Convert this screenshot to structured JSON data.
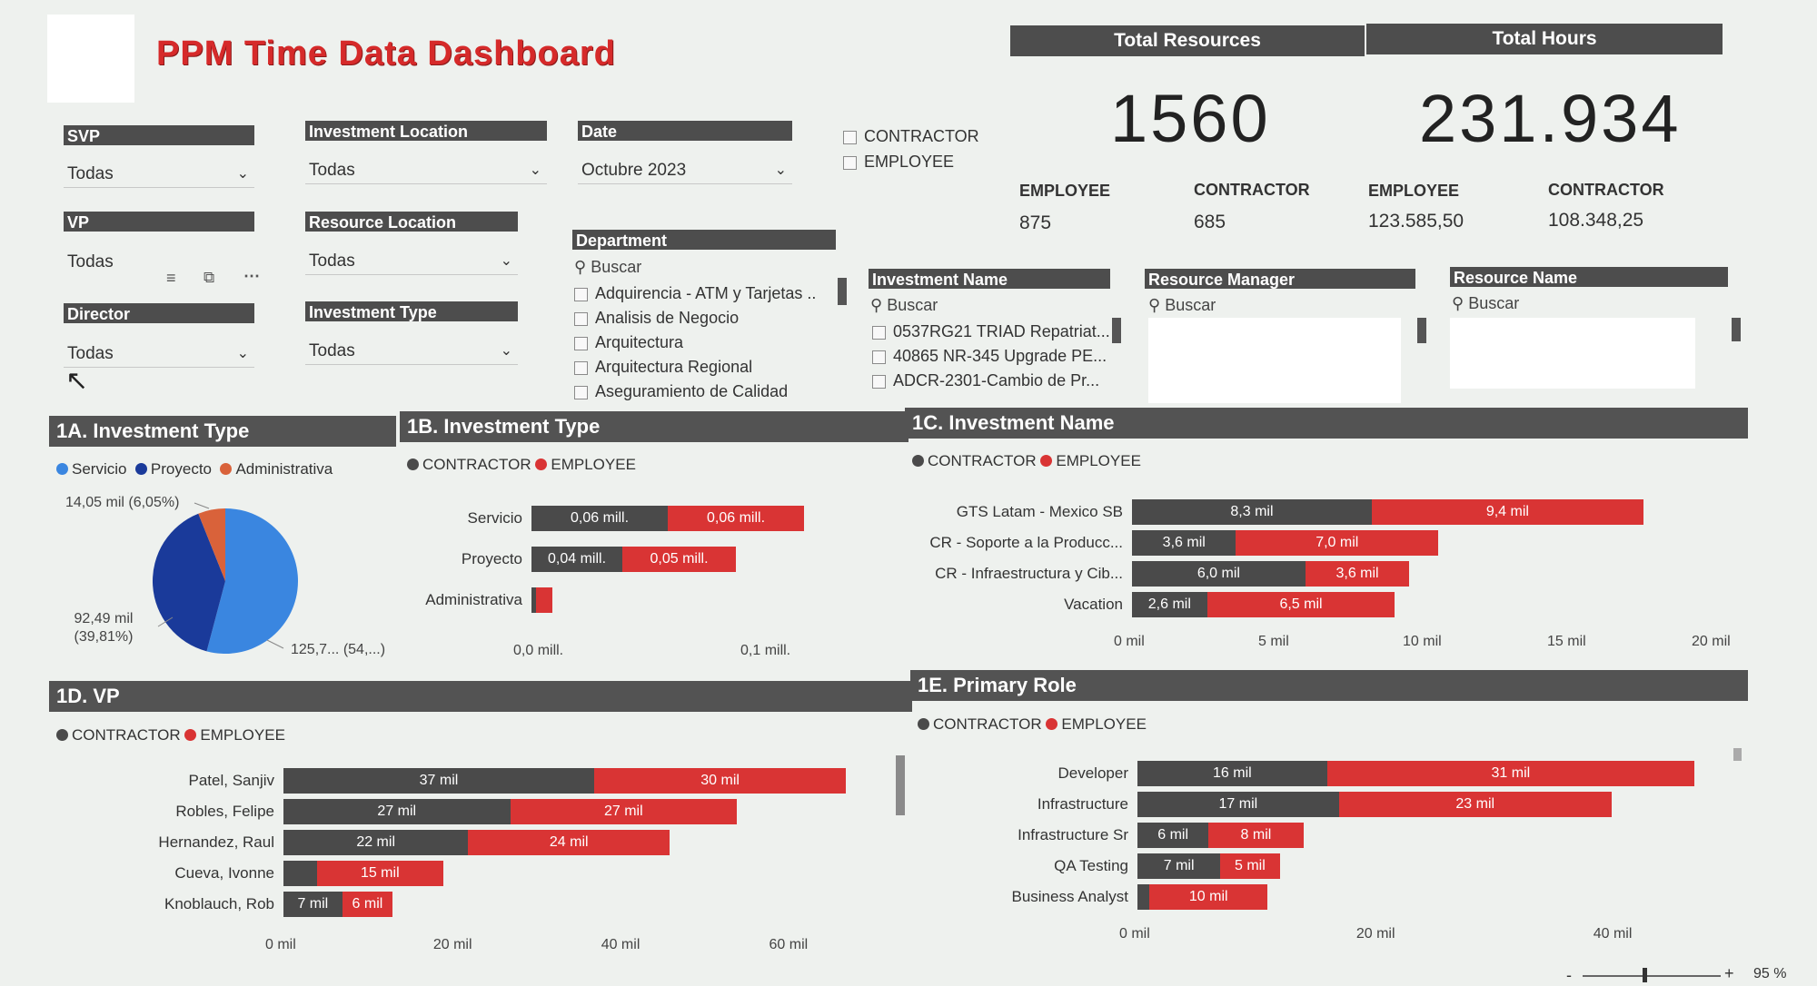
{
  "header": {
    "title": "PPM Time Data Dashboard"
  },
  "filters": {
    "svp": {
      "label": "SVP",
      "value": "Todas"
    },
    "vp": {
      "label": "VP",
      "value": "Todas"
    },
    "director": {
      "label": "Director",
      "value": "Todas"
    },
    "investment_location": {
      "label": "Investment Location",
      "value": "Todas"
    },
    "resource_location": {
      "label": "Resource Location",
      "value": "Todas"
    },
    "investment_type": {
      "label": "Investment Type",
      "value": "Todas"
    },
    "date": {
      "label": "Date",
      "value": "Octubre 2023"
    },
    "resource_type": {
      "options": [
        "CONTRACTOR",
        "EMPLOYEE"
      ]
    },
    "department": {
      "label": "Department",
      "search": "Buscar",
      "items": [
        "Adquirencia - ATM y Tarjetas ..",
        "Analisis de Negocio",
        "Arquitectura",
        "Arquitectura Regional",
        "Aseguramiento de Calidad"
      ]
    },
    "investment_name": {
      "label": "Investment Name",
      "search": "Buscar",
      "items": [
        "0537RG21 TRIAD Repatriat...",
        "40865 NR-345 Upgrade PE...",
        "ADCR-2301-Cambio de Pr..."
      ]
    },
    "resource_manager": {
      "label": "Resource Manager",
      "search": "Buscar"
    },
    "resource_name": {
      "label": "Resource Name",
      "search": "Buscar"
    }
  },
  "kpis": {
    "total_resources": {
      "label": "Total Resources",
      "value": "1560",
      "employee_label": "EMPLOYEE",
      "employee_value": "875",
      "contractor_label": "CONTRACTOR",
      "contractor_value": "685"
    },
    "total_hours": {
      "label": "Total Hours",
      "value": "231.934",
      "employee_label": "EMPLOYEE",
      "employee_value": "123.585,50",
      "contractor_label": "CONTRACTOR",
      "contractor_value": "108.348,25"
    }
  },
  "colors": {
    "contractor": "#4a4a4a",
    "employee": "#d93434",
    "servicio": "#3a86e0",
    "proyecto": "#1a3a9a",
    "administrativa": "#d9623a"
  },
  "legend": {
    "contractor": "CONTRACTOR",
    "employee": "EMPLOYEE"
  },
  "chart_data": [
    {
      "id": "1A",
      "type": "pie",
      "title": "1A. Investment Type",
      "labels": [
        "Servicio",
        "Proyecto",
        "Administrativa"
      ],
      "values": [
        125.7,
        92.49,
        14.05
      ],
      "data_labels": [
        "125,7... (54,...)",
        "92,49 mil\n(39,81%)",
        "14,05 mil (6,05%)"
      ],
      "legend_position": "top"
    },
    {
      "id": "1B",
      "type": "bar",
      "orientation": "horizontal",
      "stacked": true,
      "title": "1B. Investment Type",
      "categories": [
        "Servicio",
        "Proyecto",
        "Administrativa"
      ],
      "series": [
        {
          "name": "CONTRACTOR",
          "values": [
            0.06,
            0.04,
            0.002
          ],
          "labels": [
            "0,06 mill.",
            "0,04 mill.",
            ""
          ]
        },
        {
          "name": "EMPLOYEE",
          "values": [
            0.06,
            0.05,
            0.007
          ],
          "labels": [
            "0,06 mill.",
            "0,05 mill.",
            ""
          ]
        }
      ],
      "x_ticks": [
        "0,0 mill.",
        "0,1 mill."
      ],
      "xlim": [
        0,
        0.1
      ]
    },
    {
      "id": "1C",
      "type": "bar",
      "orientation": "horizontal",
      "stacked": true,
      "title": "1C. Investment Name",
      "categories": [
        "GTS Latam - Mexico SB",
        "CR - Soporte a la Producc...",
        "CR - Infraestructura y Cib...",
        "Vacation"
      ],
      "series": [
        {
          "name": "CONTRACTOR",
          "values": [
            8.3,
            3.6,
            6.0,
            2.6
          ],
          "labels": [
            "8,3 mil",
            "3,6 mil",
            "6,0 mil",
            "2,6 mil"
          ]
        },
        {
          "name": "EMPLOYEE",
          "values": [
            9.4,
            7.0,
            3.6,
            6.5
          ],
          "labels": [
            "9,4 mil",
            "7,0 mil",
            "3,6 mil",
            "6,5 mil"
          ]
        }
      ],
      "x_ticks": [
        "0 mil",
        "5 mil",
        "10 mil",
        "15 mil",
        "20 mil"
      ],
      "xlim": [
        0,
        20
      ]
    },
    {
      "id": "1D",
      "type": "bar",
      "orientation": "horizontal",
      "stacked": true,
      "title": "1D. VP",
      "categories": [
        "Patel, Sanjiv",
        "Robles, Felipe",
        "Hernandez, Raul",
        "Cueva, Ivonne",
        "Knoblauch, Rob"
      ],
      "series": [
        {
          "name": "CONTRACTOR",
          "values": [
            37,
            27,
            22,
            4,
            7
          ],
          "labels": [
            "37 mil",
            "27 mil",
            "22 mil",
            "",
            "7 mil"
          ]
        },
        {
          "name": "EMPLOYEE",
          "values": [
            30,
            27,
            24,
            15,
            6
          ],
          "labels": [
            "30 mil",
            "27 mil",
            "24 mil",
            "15 mil",
            "6 mil"
          ]
        }
      ],
      "x_ticks": [
        "0 mil",
        "20 mil",
        "40 mil",
        "60 mil"
      ],
      "xlim": [
        0,
        66
      ]
    },
    {
      "id": "1E",
      "type": "bar",
      "orientation": "horizontal",
      "stacked": true,
      "title": "1E. Primary Role",
      "categories": [
        "Developer",
        "Infrastructure",
        "Infrastructure Sr",
        "QA Testing",
        "Business Analyst"
      ],
      "series": [
        {
          "name": "CONTRACTOR",
          "values": [
            16,
            17,
            6,
            7,
            1
          ],
          "labels": [
            "16 mil",
            "17 mil",
            "6 mil",
            "7 mil",
            ""
          ]
        },
        {
          "name": "EMPLOYEE",
          "values": [
            31,
            23,
            8,
            5,
            10
          ],
          "labels": [
            "31 mil",
            "23 mil",
            "8 mil",
            "5 mil",
            "10 mil"
          ]
        }
      ],
      "x_ticks": [
        "0 mil",
        "20 mil",
        "40 mil"
      ],
      "xlim": [
        0,
        46
      ]
    }
  ],
  "statusbar": {
    "zoom_minus": "-",
    "zoom_plus": "+",
    "zoom": "95 %"
  }
}
